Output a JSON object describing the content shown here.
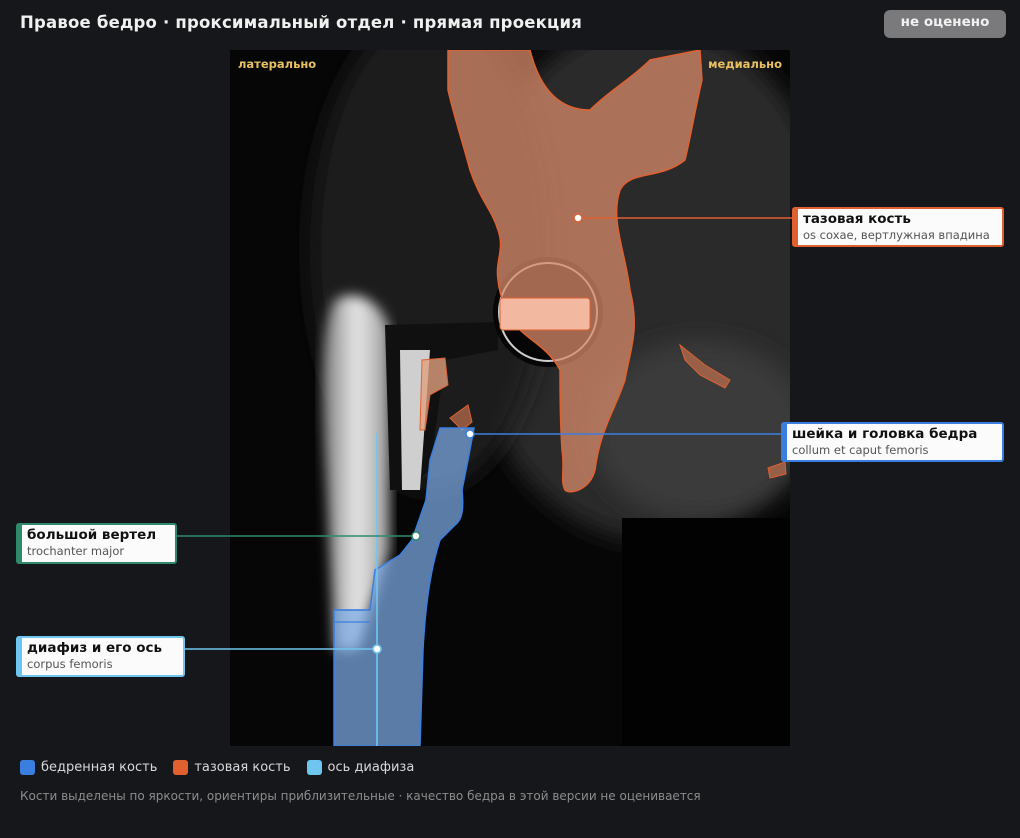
{
  "header": {
    "title": "Правое бедро · проксимальный отдел · прямая проекция",
    "status": "не оценено"
  },
  "viewer": {
    "lateral_label": "латерально",
    "medial_label": "медиально"
  },
  "colors": {
    "femur": "#3a7fe0",
    "pelvis": "#e06030",
    "shaft_axis": "#6ec6ee",
    "trochanter": "#2e8a6a"
  },
  "callouts": {
    "pelvis": {
      "name": "тазовая кость",
      "latin": "os coxae, вертлужная впадина"
    },
    "neck": {
      "name": "шейка и головка бедра",
      "latin": "collum et caput femoris"
    },
    "trochanter": {
      "name": "большой вертел",
      "latin": "trochanter major"
    },
    "shaft": {
      "name": "диафиз и его ось",
      "latin": "corpus femoris"
    }
  },
  "legend": [
    {
      "label": "бедренная кость",
      "color": "#3a7fe0"
    },
    {
      "label": "тазовая кость",
      "color": "#e06030"
    },
    {
      "label": "ось диафиза",
      "color": "#6ec6ee"
    }
  ],
  "footnote": "Кости выделены по яркости, ориентиры приблизительные · качество бедра в этой версии не оценивается"
}
